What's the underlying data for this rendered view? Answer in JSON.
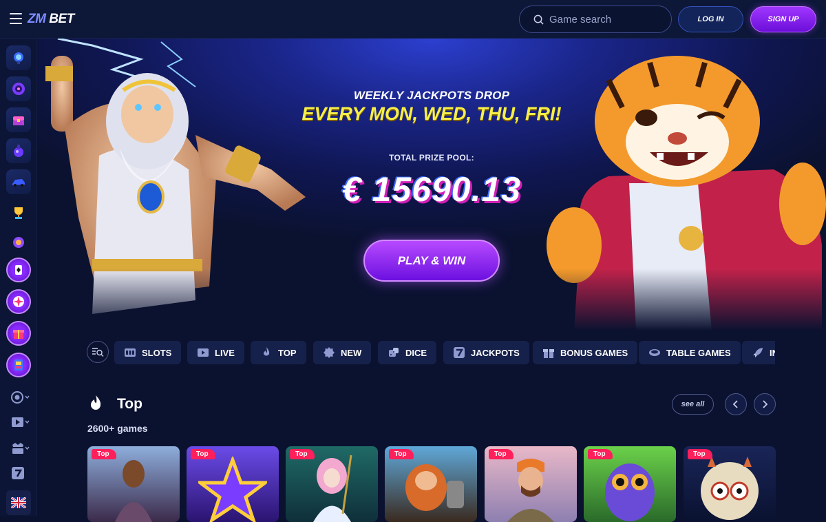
{
  "header": {
    "logo_prefix": "ZM",
    "logo_suffix": "BET",
    "search_placeholder": "Game search",
    "login_label": "LOG IN",
    "signup_label": "SIGN UP"
  },
  "sidebar": {
    "items": [
      {
        "icon": "pinball-icon"
      },
      {
        "icon": "wheel-icon"
      },
      {
        "icon": "treasure-chest-icon"
      },
      {
        "icon": "potion-icon"
      },
      {
        "icon": "car-icon"
      },
      {
        "icon": "trophy-icon"
      },
      {
        "icon": "chips-icon"
      },
      {
        "icon": "poker-card-icon"
      },
      {
        "icon": "fortune-wheel-icon"
      },
      {
        "icon": "gift-icon"
      },
      {
        "icon": "slot-machine-icon"
      }
    ],
    "bottom": [
      {
        "icon": "casino-chip-icon"
      },
      {
        "icon": "live-video-icon"
      },
      {
        "icon": "jackpot-icon"
      },
      {
        "icon": "seven-icon"
      },
      {
        "icon": "uk-flag-icon"
      }
    ]
  },
  "hero": {
    "subtitle": "WEEKLY JACKPOTS DROP",
    "title": "EVERY MON, WED, THU, FRI!",
    "prize_label": "TOTAL PRIZE POOL:",
    "prize_amount": "€ 15690.13",
    "cta_label": "PLAY & WIN"
  },
  "categories": [
    {
      "label": "SLOTS",
      "icon": "slots-icon"
    },
    {
      "label": "LIVE",
      "icon": "play-icon"
    },
    {
      "label": "TOP",
      "icon": "fire-icon"
    },
    {
      "label": "NEW",
      "icon": "new-badge-icon"
    },
    {
      "label": "DICE",
      "icon": "dice-icon"
    },
    {
      "label": "JACKPOTS",
      "icon": "seven-icon"
    },
    {
      "label": "BONUS GAMES",
      "icon": "gift-icon"
    },
    {
      "label": "TABLE GAMES",
      "icon": "table-icon"
    },
    {
      "label": "IN",
      "icon": "rocket-icon"
    }
  ],
  "section": {
    "title": "Top",
    "count": "2600+ games",
    "see_all": "see all"
  },
  "games": [
    {
      "badge": "Top",
      "colors": [
        "#7fa0d8",
        "#3b2a4a"
      ]
    },
    {
      "badge": "Top",
      "colors": [
        "#5b3ad8",
        "#2a1470"
      ]
    },
    {
      "badge": "Top",
      "colors": [
        "#1f6a66",
        "#0f2f3a"
      ]
    },
    {
      "badge": "Top",
      "colors": [
        "#5fa8d8",
        "#3a2a20"
      ]
    },
    {
      "badge": "Top",
      "colors": [
        "#e9b8c8",
        "#8d7fb0"
      ]
    },
    {
      "badge": "Top",
      "colors": [
        "#6bd14a",
        "#2a6a2a"
      ]
    },
    {
      "badge": "Top",
      "colors": [
        "#16204a",
        "#0a1230"
      ]
    }
  ]
}
